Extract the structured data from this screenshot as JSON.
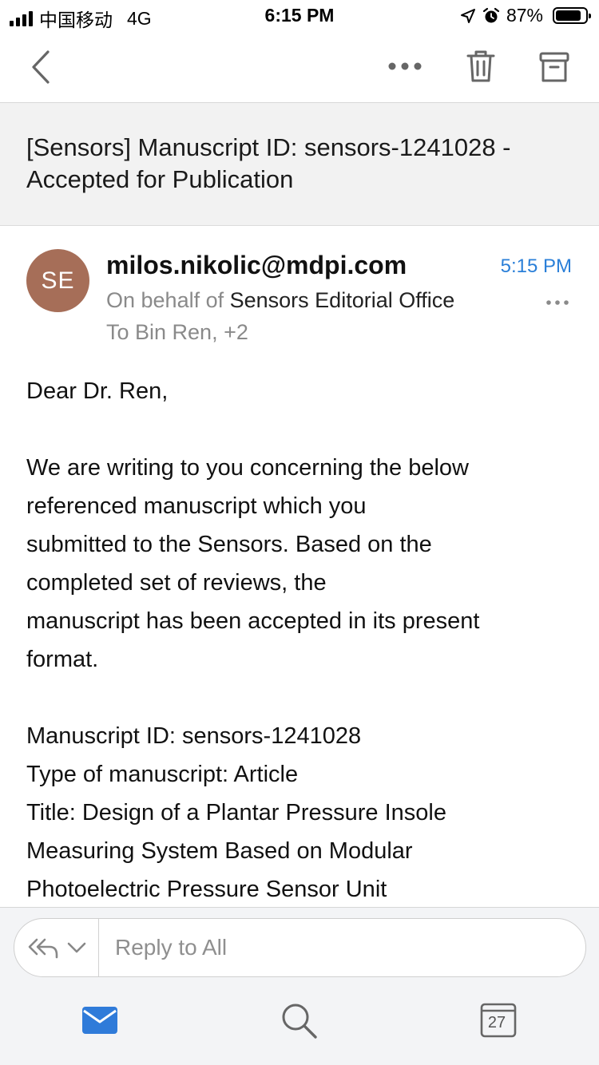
{
  "status_bar": {
    "carrier": "中国移动",
    "network": "4G",
    "time": "6:15 PM",
    "battery_percent": "87%",
    "battery_level": 0.87
  },
  "toolbar": {
    "back_icon": "chevron-left-icon",
    "more_icon": "ellipsis-icon",
    "delete_icon": "trash-icon",
    "archive_icon": "archive-icon"
  },
  "email": {
    "subject": "[Sensors] Manuscript ID: sensors-1241028 - Accepted for Publication",
    "sender_initials": "SE",
    "sender_email": "milos.nikolic@mdpi.com",
    "time": "5:15 PM",
    "on_behalf_prefix": "On behalf of",
    "on_behalf_name": "Sensors Editorial Office",
    "to_line": "To Bin Ren, +2",
    "greeting": "Dear Dr. Ren,",
    "paragraph_lines": [
      "We are writing to you concerning the below",
      "referenced manuscript which you",
      "submitted to the Sensors. Based on the",
      "completed set of reviews, the",
      "manuscript has been accepted in its present",
      "format."
    ],
    "details_lines": [
      "Manuscript ID: sensors-1241028",
      "Type of manuscript: Article",
      "Title: Design of a Plantar Pressure Insole",
      "Measuring System Based on Modular",
      "Photoelectric Pressure Sensor Unit"
    ]
  },
  "reply": {
    "placeholder": "Reply to All"
  },
  "tabbar": {
    "calendar_day": "27",
    "accent_color": "#2f7bd9"
  },
  "colors": {
    "avatar": "#a66e58",
    "time_accent": "#2a7fd8"
  }
}
